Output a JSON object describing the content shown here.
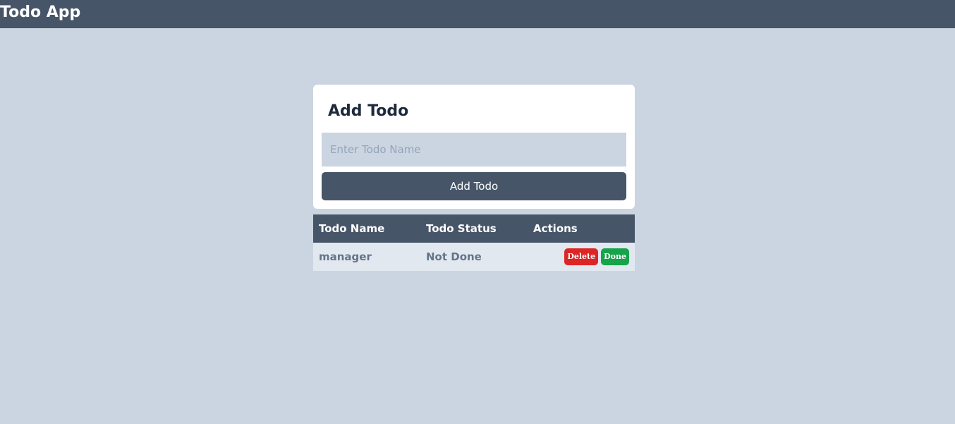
{
  "header": {
    "title": "Todo App"
  },
  "add_form": {
    "title": "Add Todo",
    "input_placeholder": "Enter Todo Name",
    "input_value": "",
    "button_label": "Add Todo"
  },
  "table": {
    "headers": {
      "name": "Todo Name",
      "status": "Todo Status",
      "actions": "Actions"
    },
    "rows": [
      {
        "name": "manager",
        "status": "Not Done",
        "delete_label": "Delete",
        "done_label": "Done"
      }
    ]
  },
  "colors": {
    "header_bg": "#475569",
    "page_bg": "#cbd5e1",
    "delete": "#dc2626",
    "done": "#16a34a"
  }
}
